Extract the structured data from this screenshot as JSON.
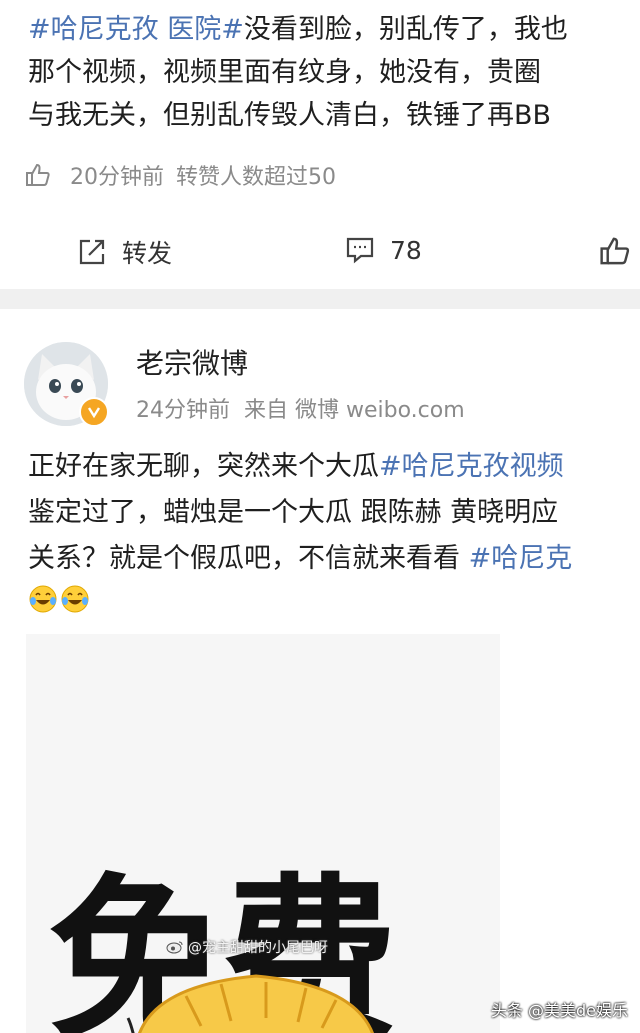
{
  "post1": {
    "line1": {
      "tag": "#哈尼克孜 医院#",
      "rest": "没看到脸，别乱传了，我也"
    },
    "line2": "那个视频，视频里面有纹身，她没有，贵圈",
    "line3": "与我无关，但别乱传毁人清白，铁锤了再BB",
    "time": "20分钟前",
    "likes_text": "转赞人数超过50"
  },
  "actions": {
    "repost_label": "转发",
    "comment_count": "78"
  },
  "post2": {
    "username": "老宗微博",
    "time": "24分钟前",
    "source_label": "来自 微博 weibo.com",
    "line1": {
      "text": "正好在家无聊，突然来个大瓜",
      "tag": "#哈尼克孜视频"
    },
    "line2": "鉴定过了，蜡烛是一个大瓜 跟陈赫 黄晓明应",
    "line3": {
      "text": "关系？就是个假瓜吧，不信就来看看 ",
      "tag": "#哈尼克"
    },
    "emojis": [
      "laugh-cry-emoji",
      "laugh-cry-emoji"
    ]
  },
  "image": {
    "big_text": "免费",
    "inner_watermark": "@宠主甜甜的小尾巴呀"
  },
  "watermark": "头条 @美美de娱乐",
  "colors": {
    "link": "#4b73b3",
    "meta": "#8a8a8a",
    "divider": "#f0f0f0",
    "badge": "#f5a623"
  }
}
